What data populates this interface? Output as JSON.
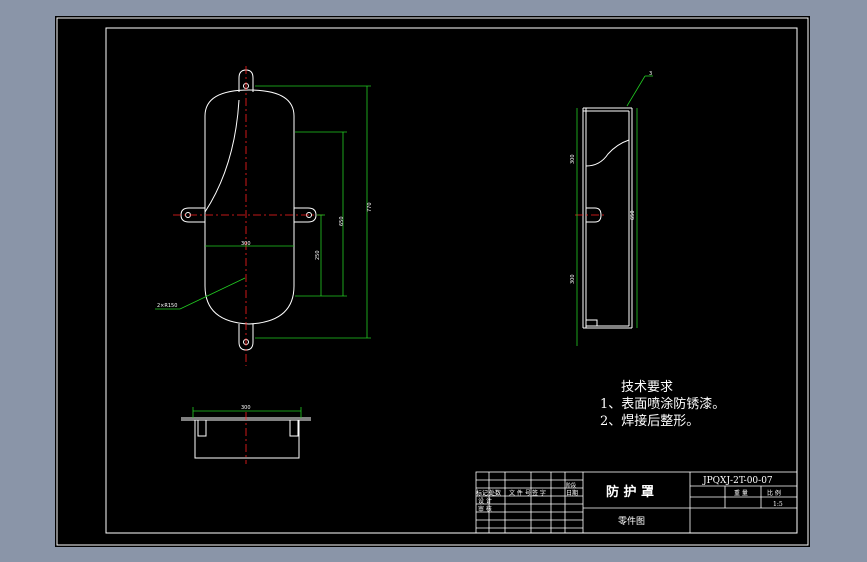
{
  "colors": {
    "background_outer": "#8a95a8",
    "sheet": "#000000",
    "outline": "#ffffff",
    "dimension": "#22cc22",
    "centerline": "#ff2020",
    "leader": "#22cc22"
  },
  "front_view": {
    "dim_width": "300",
    "dim_inner_height": "650",
    "dim_total_height": "770",
    "dim_half_height": "250",
    "radius_label": "2×R150"
  },
  "side_view": {
    "weld_symbol": "3",
    "dim_upper": "300",
    "dim_total": "650",
    "dim_lower": "300"
  },
  "bottom_view": {
    "dim_width": "300"
  },
  "technical_requirements": {
    "heading": "技术要求",
    "item_1": "1、表面喷涂防锈漆。",
    "item_2": "2、焊接后整形。"
  },
  "title_block": {
    "part_name": "防 护 罩",
    "drawing_number": "JPQXJ-2T-00-07",
    "drawing_type": "零件图",
    "label_mark": "标记",
    "label_count": "处数",
    "label_file": "文 件 号",
    "label_sign": "签 字",
    "label_date": "日期",
    "label_stage": "阶段",
    "label_design": "设 计",
    "label_check": "审 核",
    "label_weight": "重 量",
    "label_scale": "比 例",
    "scale_value": "1:5"
  }
}
